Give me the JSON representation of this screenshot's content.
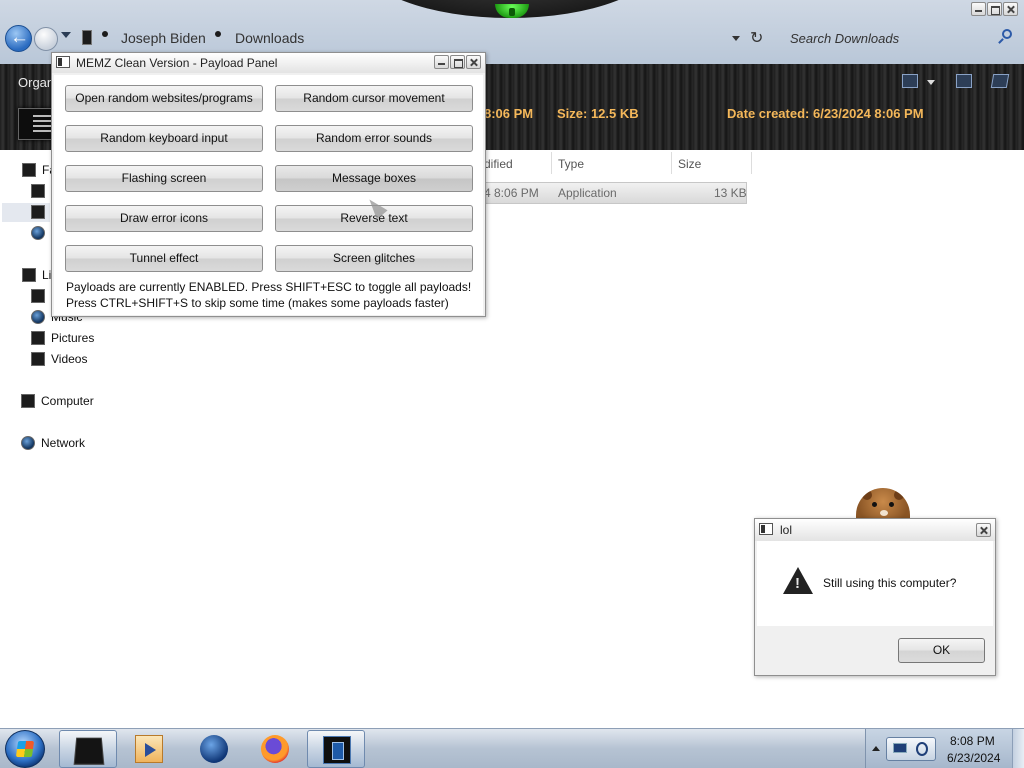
{
  "explorer": {
    "breadcrumbs": [
      "Joseph Biden",
      "Downloads"
    ],
    "search_placeholder": "Search Downloads",
    "organize_label": "Organ",
    "details": {
      "date_modified_partial": "8:06 PM",
      "size": "Size: 12.5 KB",
      "date_created": "Date created: 6/23/2024 8:06 PM"
    },
    "columns": {
      "modified_partial": "dified",
      "type": "Type",
      "size": "Size"
    },
    "file_row": {
      "modified_partial": "4 8:06 PM",
      "type": "Application",
      "size": "13 KB"
    },
    "nav": {
      "favorites_partial": "Fa",
      "libraries_partial": "Li",
      "music": "Music",
      "pictures": "Pictures",
      "videos": "Videos",
      "computer": "Computer",
      "network": "Network"
    }
  },
  "memz": {
    "title": "MEMZ Clean Version - Payload Panel",
    "buttons": [
      "Open random websites/programs",
      "Random cursor movement",
      "Random keyboard input",
      "Random error sounds",
      "Flashing screen",
      "Message boxes",
      "Draw error icons",
      "Reverse text",
      "Tunnel effect",
      "Screen glitches"
    ],
    "info_line1": "Payloads are currently ENABLED. Press SHIFT+ESC to toggle all payloads!",
    "info_line2": "Press CTRL+SHIFT+S to skip some time (makes some payloads faster)"
  },
  "dialog": {
    "title": "lol",
    "message": "Still using this computer?",
    "ok_label": "OK"
  },
  "taskbar": {
    "time": "8:08 PM",
    "date": "6/23/2024",
    "apps": [
      "explorer-icon",
      "media-player-icon",
      "internet-explorer-icon",
      "firefox-icon",
      "memz-icon"
    ]
  },
  "colors": {
    "detail_text": "#f5b85a",
    "toolbar_bg": "#252525",
    "taskbar_bg": "#b6c3d3"
  }
}
